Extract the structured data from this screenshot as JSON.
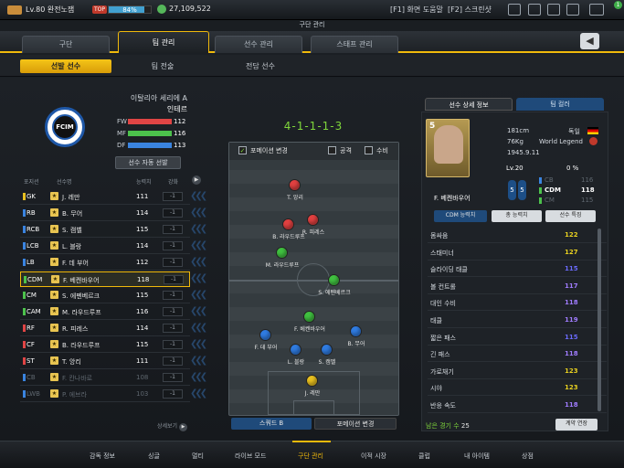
{
  "topbar": {
    "level": "Lv.80 완전노잼",
    "rank_badge": "TOP",
    "exp_percent": "84%",
    "exp_value": 0.84,
    "coins": "27,109,522",
    "help": "[F1] 화면 도움말",
    "script": "[F2] 스크린샷",
    "icons": [
      "mail-icon",
      "person-icon",
      "calendar-icon",
      "chat-icon",
      "menu-icon"
    ],
    "notify_count": "1"
  },
  "section_title": "구단 관리",
  "tabs": [
    "구단",
    "팀 관리",
    "선수 관리",
    "스태프 관리"
  ],
  "active_tab": 1,
  "subtabs": [
    "선발 선수",
    "팀 전술",
    "전담 선수"
  ],
  "active_subtab": 0,
  "team": {
    "league": "이탈리아 세리에 A",
    "name": "인테르",
    "logo_text": "FCIM",
    "stats": [
      {
        "label": "FW",
        "value": "112",
        "color": "#e04545"
      },
      {
        "label": "MF",
        "value": "116",
        "color": "#4cc24c"
      },
      {
        "label": "DF",
        "value": "113",
        "color": "#3a84e0"
      }
    ],
    "auto_select": "선수 자동 선발"
  },
  "list": {
    "headers": [
      "포지션",
      "선수명",
      "능력치",
      "강화"
    ],
    "players": [
      {
        "pos": "GK",
        "name": "J. 레만",
        "ovr": "111",
        "fit": "-1",
        "color": "#e8c020"
      },
      {
        "pos": "RB",
        "name": "B. 무어",
        "ovr": "114",
        "fit": "-1",
        "color": "#3a84e0"
      },
      {
        "pos": "RCB",
        "name": "S. 캠벨",
        "ovr": "115",
        "fit": "-1",
        "color": "#3a84e0"
      },
      {
        "pos": "LCB",
        "name": "L. 블랑",
        "ovr": "114",
        "fit": "-1",
        "color": "#3a84e0"
      },
      {
        "pos": "LB",
        "name": "F. 데 부어",
        "ovr": "112",
        "fit": "-1",
        "color": "#3a84e0"
      },
      {
        "pos": "CDM",
        "name": "F. 베켄바우어",
        "ovr": "118",
        "fit": "-1",
        "color": "#4cc24c"
      },
      {
        "pos": "CM",
        "name": "S. 에펜베르크",
        "ovr": "115",
        "fit": "-1",
        "color": "#4cc24c"
      },
      {
        "pos": "CAM",
        "name": "M. 라우드루프",
        "ovr": "116",
        "fit": "-1",
        "color": "#4cc24c"
      },
      {
        "pos": "RF",
        "name": "R. 피레스",
        "ovr": "114",
        "fit": "-1",
        "color": "#e04545"
      },
      {
        "pos": "CF",
        "name": "B. 라우드루프",
        "ovr": "115",
        "fit": "-1",
        "color": "#e04545"
      },
      {
        "pos": "ST",
        "name": "T. 앙리",
        "ovr": "111",
        "fit": "-1",
        "color": "#e04545"
      },
      {
        "pos": "CB",
        "name": "F. 칸나바로",
        "ovr": "108",
        "fit": "-1",
        "color": "#3a84e0"
      },
      {
        "pos": "LWB",
        "name": "P. 에브라",
        "ovr": "103",
        "fit": "-1",
        "color": "#3a84e0"
      }
    ],
    "selected_index": 5,
    "detail_link": "상세보기"
  },
  "pitch": {
    "formation": "4-1-1-1-3",
    "formation_change": "포메이션 변경",
    "attack": "공격",
    "defense": "수비",
    "players": [
      {
        "name": "T. 앙리",
        "color": "#e04040"
      },
      {
        "name": "R. 피레스",
        "color": "#e04040"
      },
      {
        "name": "B. 라우드루프",
        "color": "#e04040"
      },
      {
        "name": "M. 라우드루프",
        "color": "#40c040"
      },
      {
        "name": "S. 에펜베르크",
        "color": "#40c040"
      },
      {
        "name": "F. 베켄바우어",
        "color": "#40c040"
      },
      {
        "name": "F. 데 부어",
        "color": "#2f7be0"
      },
      {
        "name": "B. 무어",
        "color": "#2f7be0"
      },
      {
        "name": "L. 블랑",
        "color": "#2f7be0"
      },
      {
        "name": "S. 캠벨",
        "color": "#2f7be0"
      },
      {
        "name": "J. 레만",
        "color": "#e8c020"
      }
    ],
    "squad_btn": "스쿼드 B",
    "formation_btn": "포메이션 변경"
  },
  "right": {
    "tabs": [
      "선수 상세 정보",
      "팀 컬러"
    ],
    "card_number": "5",
    "name": "F. 베켄바우어",
    "height": "181cm",
    "weight": "76Kg",
    "birth": "1945.9.11",
    "nation": "독일",
    "season": "World Legend",
    "level": "Lv.20",
    "percent": "0 %",
    "boot_left": "5",
    "boot_right": "5",
    "alt_positions": [
      {
        "pos": "CB",
        "value": "116",
        "color": "#3a84e0",
        "dim": true
      },
      {
        "pos": "CDM",
        "value": "118",
        "color": "#4cc24c",
        "dim": false
      },
      {
        "pos": "CM",
        "value": "115",
        "color": "#4cc24c",
        "dim": true
      }
    ],
    "buttons": [
      "CDM 능력치",
      "총 능력치",
      "선수 특징"
    ],
    "attributes": [
      {
        "name": "몸싸움",
        "value": "122",
        "color": "#e8d020"
      },
      {
        "name": "스태미너",
        "value": "127",
        "color": "#e8d020"
      },
      {
        "name": "슬라이딩 태클",
        "value": "115",
        "color": "#6b6bff"
      },
      {
        "name": "볼 컨트롤",
        "value": "117",
        "color": "#a07cff"
      },
      {
        "name": "대인 수비",
        "value": "118",
        "color": "#a07cff"
      },
      {
        "name": "태클",
        "value": "119",
        "color": "#a07cff"
      },
      {
        "name": "짧은 패스",
        "value": "115",
        "color": "#6b6bff"
      },
      {
        "name": "긴 패스",
        "value": "118",
        "color": "#a07cff"
      },
      {
        "name": "가로채기",
        "value": "123",
        "color": "#e8d020"
      },
      {
        "name": "시야",
        "value": "123",
        "color": "#e8d020"
      },
      {
        "name": "반응 속도",
        "value": "118",
        "color": "#a07cff"
      }
    ],
    "remaining_label": "남은 경기 수",
    "remaining_value": "25",
    "contract_btn": "계약 연장"
  },
  "bottomnav": [
    "감독 정보",
    "싱글",
    "멀티",
    "라이브 모드",
    "구단 관리",
    "이적 시장",
    "클럽",
    "내 아이템",
    "상점"
  ],
  "active_nav": 4
}
